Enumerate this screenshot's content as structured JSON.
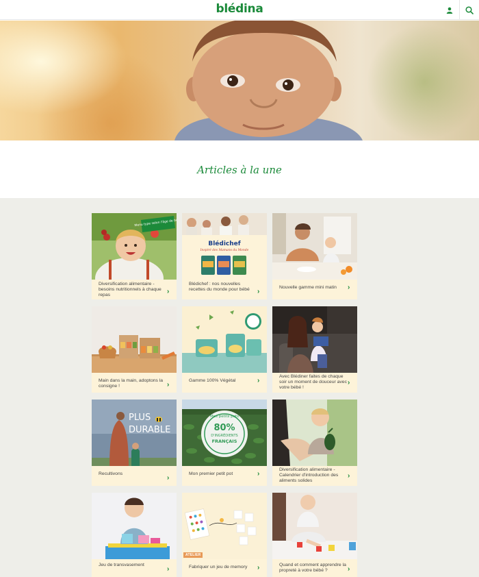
{
  "header": {
    "logo_text": "blédina",
    "user_icon": "user-icon",
    "search_icon": "search-icon",
    "brand_color": "#1b8a3a"
  },
  "section": {
    "title": "Articles à la une"
  },
  "cards": [
    {
      "caption": "Diversification alimentaire - besoins nutritionnels à chaque repas",
      "image_text": "Menu type selon l'âge de bébé"
    },
    {
      "caption": "Blédichef : nos nouvelles recettes du monde pour bébé",
      "image_text_1": "Blédichef",
      "image_text_2": "Inspiré des Mamans du Monde"
    },
    {
      "caption": "Nouvelle gamme mini matin"
    },
    {
      "caption": "Main dans la main, adoptons la consigne !"
    },
    {
      "caption": "Gamme 100% Végétal"
    },
    {
      "caption": "Avec Blédiner faites de chaque soir un moment de douceur avec votre bébé !"
    },
    {
      "caption": "Recultivons",
      "image_text_1": "PLUS",
      "image_text_2": "DURABLE"
    },
    {
      "caption": "Mon premier petit pot",
      "image_text_1": "Mes petits pots",
      "image_text_2": "80%",
      "image_text_3": "D'INGRÉDIENTS",
      "image_text_4": "FRANÇAIS"
    },
    {
      "caption": "Diversification alimentaire - Calendrier d'introduction des aliments solides"
    },
    {
      "caption": "Jeu de transvasement"
    },
    {
      "caption": "Fabriquer un jeu de memory",
      "badge": "ATELIER"
    },
    {
      "caption": "Quand et comment apprendre la propreté à votre bébé ?"
    }
  ]
}
